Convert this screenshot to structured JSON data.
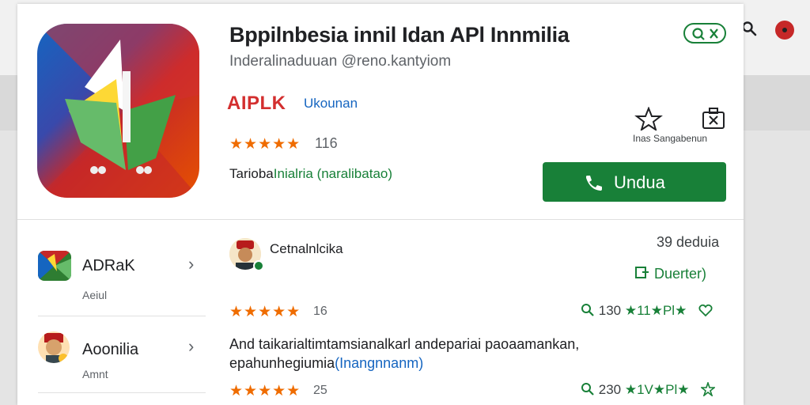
{
  "app": {
    "title": "Bppilnbesia innil Idan APl Innmilia",
    "subtitle": "Inderalinaduuan @reno.kantyiom",
    "brand": "AIPLK",
    "developer": "Ukounan",
    "rating_stars": "★★★★★",
    "rating_count": "116",
    "category_prefix": "Tarioba",
    "category_highlight": "Inialria (naralibatao)",
    "install_label": "Undua",
    "actions_label": "Inas Sangabenun",
    "brand_color": "#188038"
  },
  "sidebar": {
    "items": [
      {
        "name": "ADRaK",
        "sub": "Aeiul",
        "icon": "app-icon-green"
      },
      {
        "name": "Aoonilia",
        "sub": "Amnt",
        "icon": "avatar-icon"
      }
    ]
  },
  "review": {
    "author": "Cetnalnlcika",
    "size": "39 deduia",
    "details_label": "Duerter)",
    "row1": {
      "stars": "★★★★★",
      "count": "16",
      "meta_count": "130",
      "meta_stars": "★11★Pl★"
    },
    "text_main": "And taikarialtimtamsianalkarl andepariai paoaamankan,",
    "text_line2": "epahunhegiumia",
    "text_highlight": "(Inangnnanm)",
    "row2": {
      "stars": "★★★★★",
      "count": "25",
      "meta_count": "230",
      "meta_stars": "★1V★Pl★"
    }
  }
}
